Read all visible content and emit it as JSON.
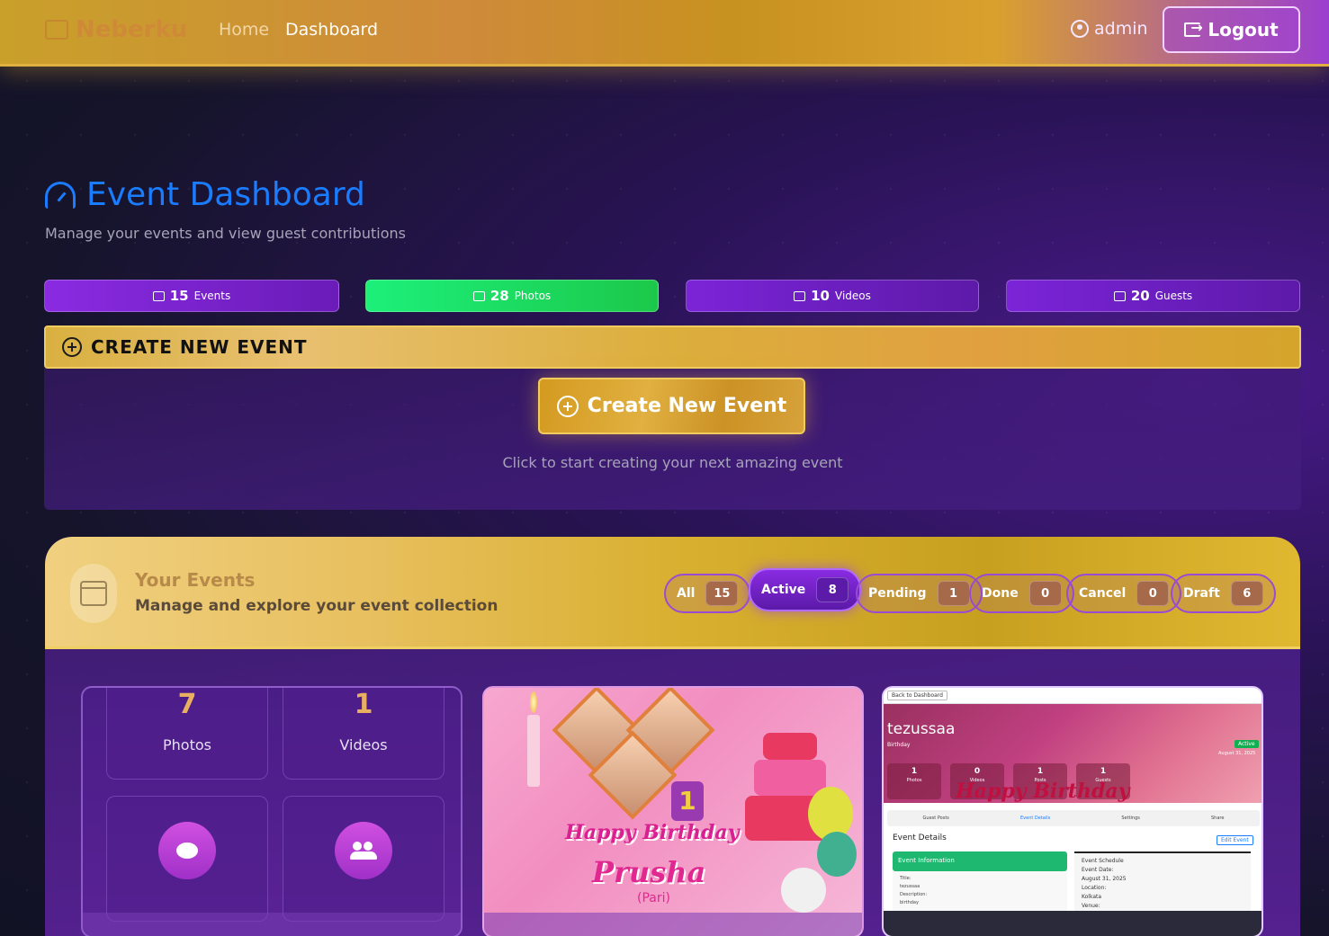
{
  "nav": {
    "brand": "Neberku",
    "links": [
      {
        "label": "Home"
      },
      {
        "label": "Dashboard"
      }
    ],
    "user": "admin",
    "logout_label": "Logout"
  },
  "header": {
    "title": "Event Dashboard",
    "subtitle": "Manage your events and view guest contributions"
  },
  "stats": [
    {
      "value": "15",
      "label": "Events",
      "icon": "calendar-icon",
      "color": "#8a2be2"
    },
    {
      "value": "28",
      "label": "Photos",
      "icon": "image-icon",
      "color": "#1cf07a"
    },
    {
      "value": "10",
      "label": "Videos",
      "icon": "video-icon",
      "color": "#7b24d8"
    },
    {
      "value": "20",
      "label": "Guests",
      "icon": "people-icon",
      "color": "#7b24d8"
    }
  ],
  "create": {
    "section_title": "CREATE NEW EVENT",
    "button_label": "Create New Event",
    "hint": "Click to start creating your next amazing event"
  },
  "events": {
    "title": "Your Events",
    "subtitle": "Manage and explore your event collection",
    "filters": [
      {
        "label": "All",
        "count": "15",
        "active": false
      },
      {
        "label": "Active",
        "count": "8",
        "active": true
      },
      {
        "label": "Pending",
        "count": "1",
        "active": false
      },
      {
        "label": "Done",
        "count": "0",
        "active": false
      },
      {
        "label": "Cancel",
        "count": "0",
        "active": false
      },
      {
        "label": "Draft",
        "count": "6",
        "active": false
      }
    ]
  },
  "cards": {
    "card1": {
      "photos_value": "7",
      "photos_label": "Photos",
      "videos_value": "1",
      "videos_label": "Videos",
      "icon_left": "chat-icon",
      "icon_right": "people-icon"
    },
    "card2": {
      "greeting": "Happy Birthday",
      "name": "Prusha",
      "nickname": "(Pari)",
      "number": "1"
    },
    "card3": {
      "back_label": "Back to Dashboard",
      "event_name": "tezussaa",
      "event_sub": "Birthday",
      "status": "Active",
      "date": "August 31, 2025",
      "stats": [
        {
          "value": "1",
          "label": "Photos"
        },
        {
          "value": "0",
          "label": "Videos"
        },
        {
          "value": "1",
          "label": "Posts"
        },
        {
          "value": "1",
          "label": "Guests"
        }
      ],
      "banner_text": "Happy Birthday",
      "tabs": [
        "Guest Posts",
        "Event Details",
        "Settings",
        "Share"
      ],
      "details_title": "Event Details",
      "edit_label": "Edit Event",
      "info_title": "Event Information",
      "info_lines": [
        "Title:",
        "tezussaa",
        "Description:",
        "birthday"
      ],
      "schedule_title": "Event Schedule",
      "schedule_lines": [
        "Event Date:",
        "August 31, 2025",
        "Location:",
        "Kolkata",
        "Venue:"
      ]
    }
  }
}
